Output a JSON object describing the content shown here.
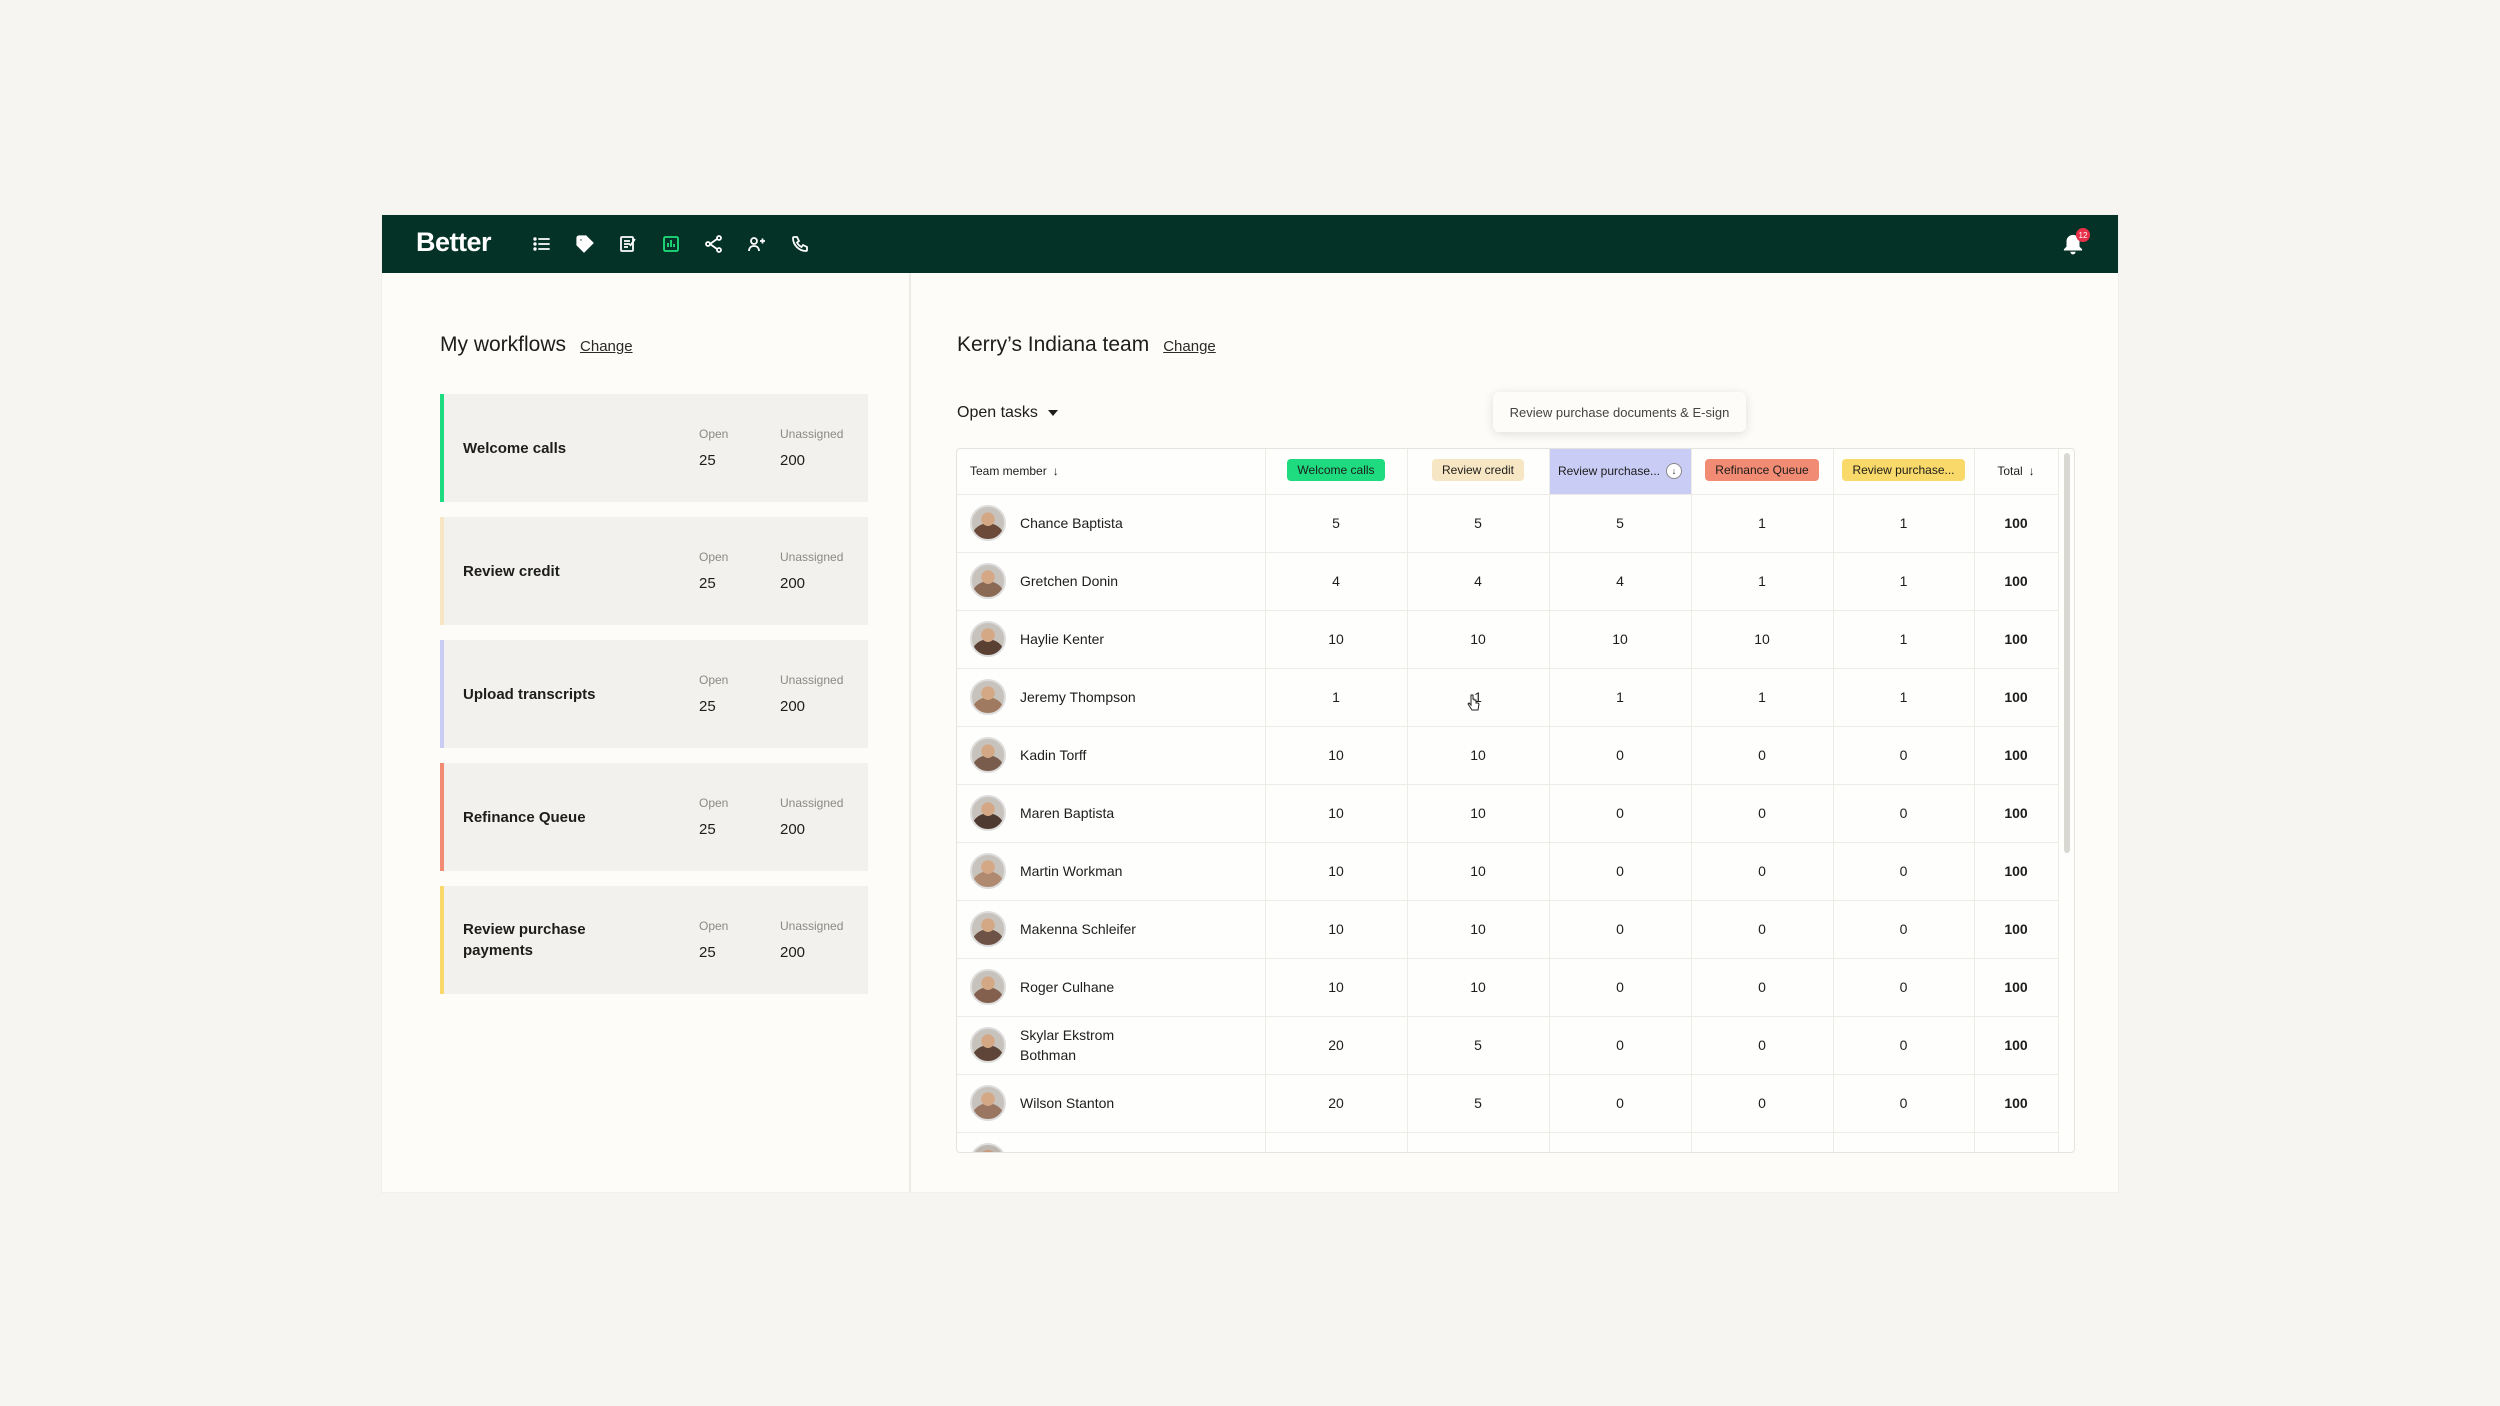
{
  "brand": "Better",
  "colors": {
    "topbar": "#053226",
    "accent_green": "#1ee17d",
    "welcome_calls": "#1fdb7f",
    "review_credit": "#f7e6c4",
    "upload_transcripts": "#c9ccf4",
    "refinance_queue": "#f28b74",
    "review_purchase": "#f8d96a",
    "notification": "#e8304a"
  },
  "nav": {
    "icons": [
      "list-icon",
      "tag-icon",
      "notes-icon",
      "chart-icon",
      "share-icon",
      "users-icon",
      "phone-icon"
    ],
    "active_index": 3,
    "notification_count": "12"
  },
  "workflows": {
    "title": "My workflows",
    "change_label": "Change",
    "open_label": "Open",
    "unassigned_label": "Unassigned",
    "items": [
      {
        "name": "Welcome calls",
        "open": "25",
        "unassigned": "200",
        "color": "#1fdb7f"
      },
      {
        "name": "Review credit",
        "open": "25",
        "unassigned": "200",
        "color": "#f7e6c4"
      },
      {
        "name": "Upload transcripts",
        "open": "25",
        "unassigned": "200",
        "color": "#c9ccf4"
      },
      {
        "name": "Refinance Queue",
        "open": "25",
        "unassigned": "200",
        "color": "#f28b74"
      },
      {
        "name": "Review purchase payments",
        "open": "25",
        "unassigned": "200",
        "color": "#f8d96a"
      }
    ]
  },
  "team": {
    "title": "Kerry’s Indiana team",
    "change_label": "Change",
    "filter_label": "Open tasks",
    "tooltip": "Review purchase documents & E-sign",
    "columns": {
      "member": "Team member",
      "welcome_calls": "Welcome calls",
      "review_credit": "Review credit",
      "review_purchase_docs": "Review purchase...",
      "refinance_queue": "Refinance Queue",
      "review_purchase_payments": "Review purchase...",
      "total": "Total"
    },
    "rows": [
      {
        "name": "Chance Baptista",
        "v": [
          "5",
          "5",
          "5",
          "1",
          "1"
        ],
        "total": "100"
      },
      {
        "name": "Gretchen Donin",
        "v": [
          "4",
          "4",
          "4",
          "1",
          "1"
        ],
        "total": "100"
      },
      {
        "name": "Haylie Kenter",
        "v": [
          "10",
          "10",
          "10",
          "10",
          "1"
        ],
        "total": "100"
      },
      {
        "name": "Jeremy Thompson",
        "v": [
          "1",
          "1",
          "1",
          "1",
          "1"
        ],
        "total": "100"
      },
      {
        "name": "Kadin Torff",
        "v": [
          "10",
          "10",
          "0",
          "0",
          "0"
        ],
        "total": "100"
      },
      {
        "name": "Maren Baptista",
        "v": [
          "10",
          "10",
          "0",
          "0",
          "0"
        ],
        "total": "100"
      },
      {
        "name": "Martin Workman",
        "v": [
          "10",
          "10",
          "0",
          "0",
          "0"
        ],
        "total": "100"
      },
      {
        "name": "Makenna Schleifer",
        "v": [
          "10",
          "10",
          "0",
          "0",
          "0"
        ],
        "total": "100"
      },
      {
        "name": "Roger Culhane",
        "v": [
          "10",
          "10",
          "0",
          "0",
          "0"
        ],
        "total": "100"
      },
      {
        "name": "Skylar Ekstrom Bothman",
        "v": [
          "20",
          "5",
          "0",
          "0",
          "0"
        ],
        "total": "100"
      },
      {
        "name": "Wilson Stanton",
        "v": [
          "20",
          "5",
          "0",
          "0",
          "0"
        ],
        "total": "100"
      }
    ]
  }
}
